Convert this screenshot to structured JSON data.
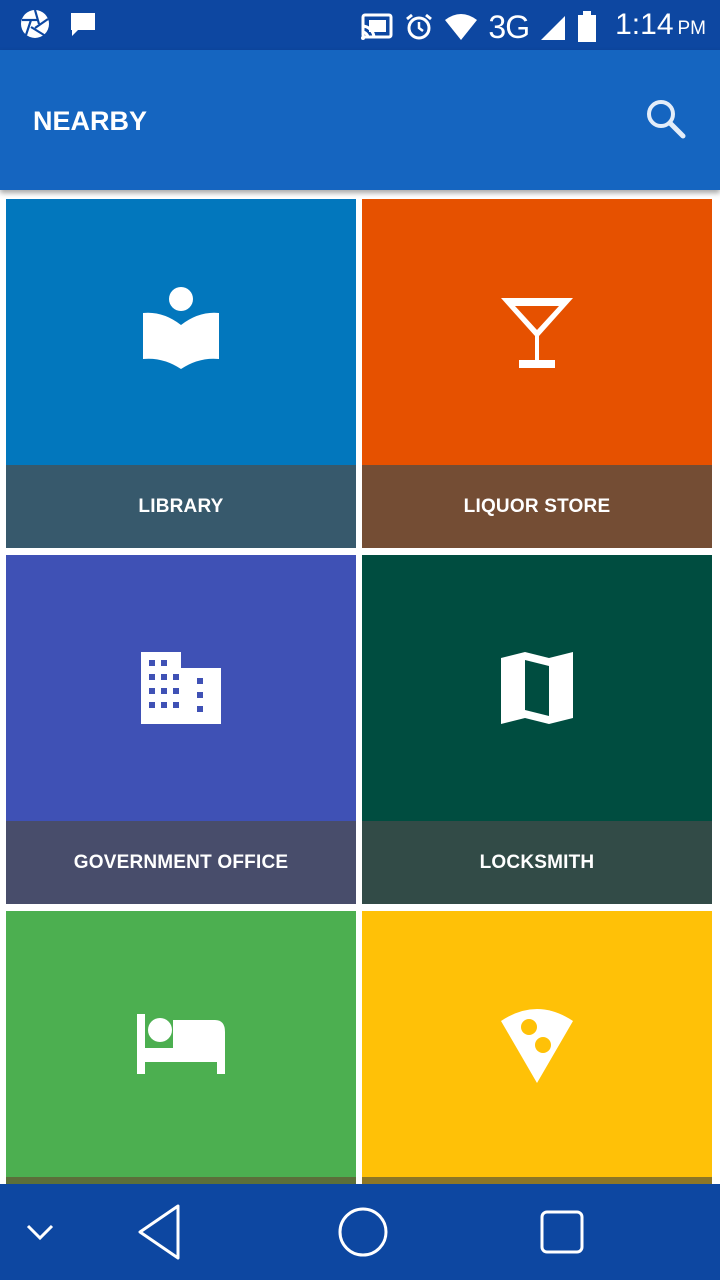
{
  "status_bar": {
    "network": "3G",
    "time": "1:14",
    "ampm": "PM",
    "icons": [
      "aperture-icon",
      "message-icon",
      "cast-icon",
      "alarm-icon",
      "wifi-icon",
      "cell-signal-icon",
      "battery-icon"
    ]
  },
  "app_bar": {
    "title": "NEARBY",
    "search_icon": "search-icon"
  },
  "tiles": [
    {
      "label": "LIBRARY",
      "icon": "library-icon",
      "top_color": "#0277BD",
      "bottom_color": "#37596C"
    },
    {
      "label": "LIQUOR STORE",
      "icon": "cocktail-icon",
      "top_color": "#E65100",
      "bottom_color": "#744D34"
    },
    {
      "label": "GOVERNMENT OFFICE",
      "icon": "building-icon",
      "top_color": "#3F51B5",
      "bottom_color": "#484D6B"
    },
    {
      "label": "LOCKSMITH",
      "icon": "map-icon",
      "top_color": "#004D40",
      "bottom_color": "#324B47"
    },
    {
      "label": "",
      "icon": "hotel-bed-icon",
      "top_color": "#4CAF50",
      "bottom_color": "#5B6F3A"
    },
    {
      "label": "",
      "icon": "pizza-icon",
      "top_color": "#FFC107",
      "bottom_color": "#8C7626"
    }
  ],
  "nav_bar": {
    "items": [
      "chevron-down-icon",
      "back-icon",
      "home-icon",
      "recents-icon"
    ]
  }
}
